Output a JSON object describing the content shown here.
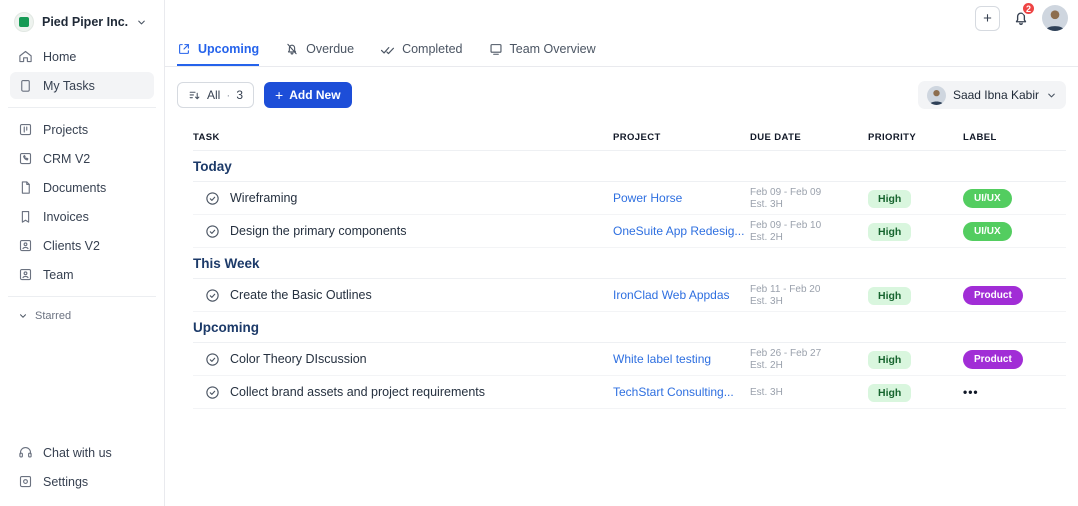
{
  "workspace": {
    "name": "Pied Piper Inc.",
    "logo_icon": "green-image-icon"
  },
  "topbar": {
    "plus_label": "+",
    "notification_count": "2",
    "icons": [
      "plus-icon",
      "bell-icon",
      "profile-avatar"
    ]
  },
  "sidebar": {
    "primary": [
      {
        "label": "Home",
        "icon": "home-icon",
        "active": false
      },
      {
        "label": "My Tasks",
        "icon": "tasks-icon",
        "active": true
      }
    ],
    "secondary": [
      {
        "label": "Projects",
        "icon": "kanban-icon"
      },
      {
        "label": "CRM V2",
        "icon": "phone-icon"
      },
      {
        "label": "Documents",
        "icon": "document-icon"
      },
      {
        "label": "Invoices",
        "icon": "invoice-icon"
      },
      {
        "label": "Clients V2",
        "icon": "client-icon"
      },
      {
        "label": "Team",
        "icon": "team-icon"
      }
    ],
    "starred_label": "Starred",
    "footer": [
      {
        "label": "Chat with us",
        "icon": "headset-icon"
      },
      {
        "label": "Settings",
        "icon": "settings-icon"
      }
    ]
  },
  "tabs": [
    {
      "label": "Upcoming",
      "icon": "calendar-upcoming-icon",
      "active": true
    },
    {
      "label": "Overdue",
      "icon": "bell-off-icon",
      "active": false
    },
    {
      "label": "Completed",
      "icon": "double-check-icon",
      "active": false
    },
    {
      "label": "Team Overview",
      "icon": "board-icon",
      "active": false
    }
  ],
  "toolbar": {
    "filter_label": "All",
    "filter_separator": "·",
    "filter_count": "3",
    "add_new_icon": "+",
    "add_new_label": "Add New",
    "user_name": "Saad Ibna Kabir"
  },
  "table": {
    "columns": [
      "TASK",
      "PROJECT",
      "DUE DATE",
      "PRIORITY",
      "LABEL"
    ],
    "sections": [
      {
        "title": "Today",
        "rows": [
          {
            "task": "Wireframing",
            "project": "Power Horse",
            "due_range": "Feb 09 - Feb 09",
            "estimate": "Est. 3H",
            "priority": "High",
            "label": "UI/UX",
            "label_color": "green"
          },
          {
            "task": "Design the primary components",
            "project": "OneSuite App Redesig...",
            "due_range": "Feb 09 - Feb 10",
            "estimate": "Est. 2H",
            "priority": "High",
            "label": "UI/UX",
            "label_color": "green"
          }
        ]
      },
      {
        "title": "This Week",
        "rows": [
          {
            "task": "Create the Basic Outlines",
            "project": "IronClad Web Appdas",
            "due_range": "Feb 11 - Feb 20",
            "estimate": "Est. 3H",
            "priority": "High",
            "label": "Product",
            "label_color": "purple"
          }
        ]
      },
      {
        "title": "Upcoming",
        "rows": [
          {
            "task": "Color Theory DIscussion",
            "project": "White label testing",
            "due_range": "Feb 26 - Feb 27",
            "estimate": "Est. 2H",
            "priority": "High",
            "label": "Product",
            "label_color": "purple"
          },
          {
            "task": "Collect brand assets and project requirements",
            "project": "TechStart Consulting...",
            "due_range": "",
            "estimate": "Est. 3H",
            "priority": "High",
            "label": "•••",
            "label_color": "more"
          }
        ]
      }
    ]
  },
  "colors": {
    "accent_blue": "#2563eb",
    "button_blue": "#1d4ed8",
    "link_blue": "#2e6fe0",
    "section_navy": "#1c3a69",
    "priority_bg": "#d9f6de",
    "priority_text": "#17652f",
    "label_green": "#53cd60",
    "label_purple": "#a12dd6",
    "badge_red": "#ee4444"
  }
}
